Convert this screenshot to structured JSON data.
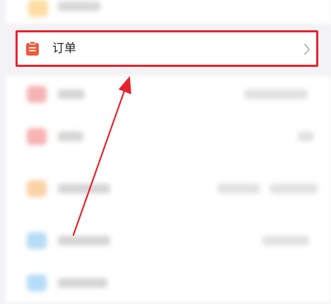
{
  "order_row": {
    "label": "订单",
    "icon": "clipboard-icon",
    "chevron_icon": "chevron-right-icon"
  },
  "colors": {
    "highlight_border": "#e8222c",
    "annotation_arrow": "#e8222c",
    "order_icon": "#f05a3c",
    "background": "#f3f3f5"
  }
}
